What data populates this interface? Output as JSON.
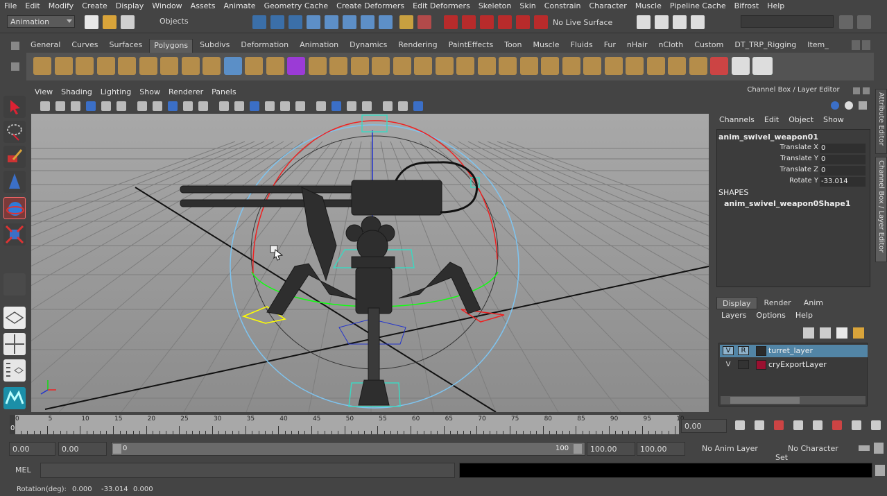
{
  "menubar": [
    "File",
    "Edit",
    "Modify",
    "Create",
    "Display",
    "Window",
    "Assets",
    "Animate",
    "Geometry Cache",
    "Create Deformers",
    "Edit Deformers",
    "Skeleton",
    "Skin",
    "Constrain",
    "Character",
    "Muscle",
    "Pipeline Cache",
    "Bifrost",
    "Help"
  ],
  "statusline": {
    "mode": "Animation",
    "selection_mask": "Objects",
    "live_surface": "No Live Surface"
  },
  "shelf": {
    "tabs": [
      "General",
      "Curves",
      "Surfaces",
      "Polygons",
      "Subdivs",
      "Deformation",
      "Animation",
      "Dynamics",
      "Rendering",
      "PaintEffects",
      "Toon",
      "Muscle",
      "Fluids",
      "Fur",
      "nHair",
      "nCloth",
      "Custom",
      "DT_TRP_Rigging",
      "Item_"
    ],
    "active_tab": "Polygons"
  },
  "viewport": {
    "menu": [
      "View",
      "Shading",
      "Lighting",
      "Show",
      "Renderer",
      "Panels"
    ]
  },
  "channel_box": {
    "title": "Channel Box / Layer Editor",
    "menu": [
      "Channels",
      "Edit",
      "Object",
      "Show"
    ],
    "object_name": "anim_swivel_weapon01",
    "attributes": [
      {
        "label": "Translate X",
        "value": "0"
      },
      {
        "label": "Translate Y",
        "value": "0"
      },
      {
        "label": "Translate Z",
        "value": "0"
      },
      {
        "label": "Rotate Y",
        "value": "-33.014"
      }
    ],
    "shapes_header": "SHAPES",
    "shape_name": "anim_swivel_weapon0Shape1"
  },
  "side_tabs": {
    "attribute_editor": "Attribute Editor",
    "channel_box": "Channel Box / Layer Editor"
  },
  "layer_editor": {
    "tabs": [
      "Display",
      "Render",
      "Anim"
    ],
    "active_tab": "Display",
    "menu": [
      "Layers",
      "Options",
      "Help"
    ],
    "layers": [
      {
        "v": "V",
        "r": "R",
        "name": "turret_layer",
        "color": "#2b2b2b",
        "selected": true
      },
      {
        "v": "V",
        "r": "",
        "name": "cryExportLayer",
        "color": "#9a1030",
        "selected": false
      }
    ]
  },
  "time_slider": {
    "ticks": [
      "0",
      "5",
      "10",
      "15",
      "20",
      "25",
      "30",
      "35",
      "40",
      "45",
      "50",
      "55",
      "60",
      "65",
      "70",
      "75",
      "80",
      "85",
      "90",
      "95",
      "10"
    ],
    "current_frame_marker": "0",
    "current_time": "0.00"
  },
  "range_slider": {
    "start_time": "0.00",
    "anim_start": "0.00",
    "range_start": "0",
    "range_end": "100",
    "anim_end": "100.00",
    "end_time": "100.00",
    "anim_layer": "No Anim Layer",
    "character_set": "No Character Set"
  },
  "command_line": {
    "language": "MEL"
  },
  "help_line": {
    "label": "Rotation(deg):",
    "x": "0.000",
    "y": "-33.014",
    "z": "0.000"
  },
  "colors": {
    "accent": "#5285a6",
    "layer_selected": "#5285a6",
    "timeslider": "#a8a8a8"
  }
}
